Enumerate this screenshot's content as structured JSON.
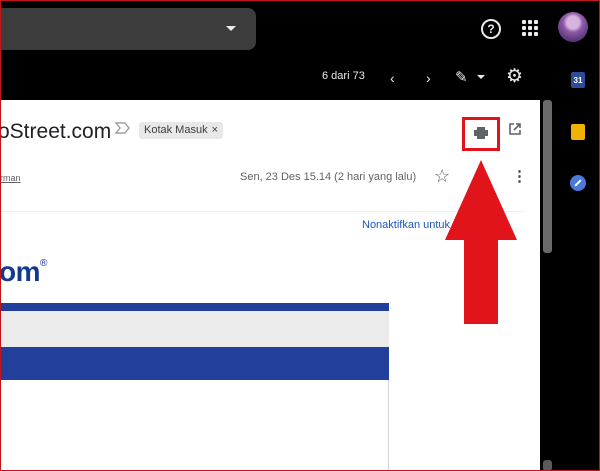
{
  "header": {
    "search_bar": "",
    "help_icon": "?",
    "apps_icon": "apps-grid",
    "avatar_icon": "user-avatar"
  },
  "toolbar": {
    "counter": "6 dari 73",
    "prev_icon": "‹",
    "next_icon": "›",
    "pencil_icon": "✎",
    "settings_icon": "⚙"
  },
  "side_panel": {
    "calendar_label": "31"
  },
  "email": {
    "subject": "oStreet.com",
    "importance_icon": "label-arrow",
    "label": "Kotak Masuk",
    "label_remove": "×",
    "print_icon": "printer",
    "open_new_window_icon": "⧉",
    "sender_link": "rman",
    "date": "Sen, 23 Des 15.14 (2 hari yang lalu)",
    "star_icon": "☆",
    "more_icon": "⋮",
    "unsubscribe": "Nonaktifkan untuk",
    "brand": "om",
    "brand_mark": "®"
  },
  "colors": {
    "annotation_red": "#e1141c",
    "brand_blue": "#213f9b",
    "link_blue": "#1a56b8"
  }
}
